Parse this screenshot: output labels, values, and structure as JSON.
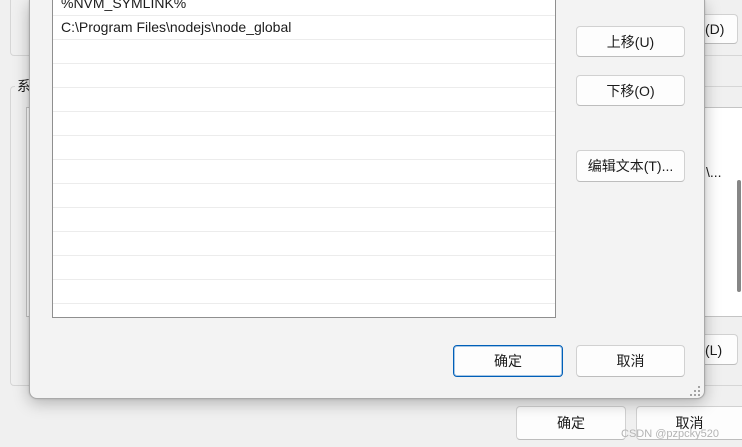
{
  "background_window": {
    "system_group_label_partial": "系",
    "user_delete_button_partial": "(D)",
    "system_list_value_partial": "\\...",
    "system_delete_button_partial": "(L)",
    "ok_button": "确定",
    "cancel_button": "取消"
  },
  "edit_dialog": {
    "paths": [
      "%NVM_SYMLINK%",
      "C:\\Program Files\\nodejs\\node_global"
    ],
    "buttons": {
      "move_up": "上移(U)",
      "move_down": "下移(O)",
      "edit_text": "编辑文本(T)...",
      "ok": "确定",
      "cancel": "取消"
    }
  },
  "watermark": "CSDN @pzpcky520",
  "colors": {
    "accent": "#005fb8",
    "window_bg": "#f0f0f0",
    "dialog_bg": "#f3f3f3",
    "list_bg": "#ffffff",
    "button_bg": "#fdfdfd"
  }
}
